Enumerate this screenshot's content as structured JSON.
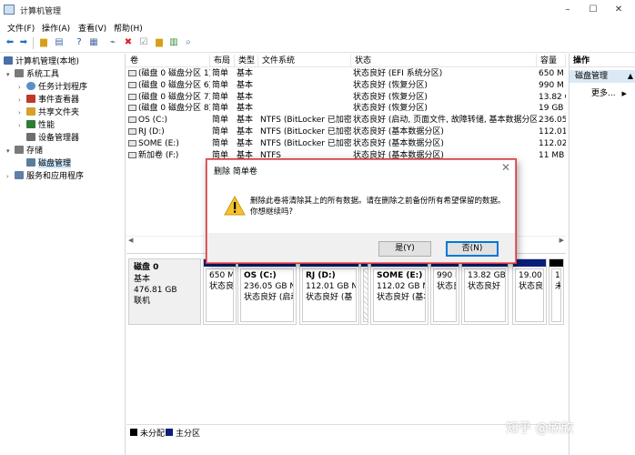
{
  "window": {
    "title": "计算机管理",
    "controls": [
      "–",
      "☐",
      "✕"
    ]
  },
  "menu": [
    "文件(F)",
    "操作(A)",
    "查看(V)",
    "帮助(H)"
  ],
  "toolbar": {
    "buttons": [
      "back-arrow-icon",
      "forward-arrow-icon",
      "folder-up-icon",
      "show-hide-tree-icon",
      "help-icon",
      "properties-icon",
      "connect-icon",
      "delete-icon",
      "check-icon",
      "folder-icon",
      "export-icon",
      "search-icon"
    ]
  },
  "tree": {
    "items": [
      {
        "label": "计算机管理(本地)",
        "twisty": "",
        "color": "#4a6fa5"
      },
      {
        "label": "系统工具",
        "twisty": "▾",
        "color": "#7a7a7a"
      },
      {
        "label": "任务计划程序",
        "twisty": "›",
        "color": "#5b8fc9"
      },
      {
        "label": "事件查看器",
        "twisty": "›",
        "color": "#c0392b"
      },
      {
        "label": "共享文件夹",
        "twisty": "›",
        "color": "#d6a02a"
      },
      {
        "label": "性能",
        "twisty": "›",
        "color": "#2e7d32"
      },
      {
        "label": "设备管理器",
        "twisty": "",
        "color": "#6d6d6d"
      },
      {
        "label": "存储",
        "twisty": "▾",
        "color": "#7a7a7a"
      },
      {
        "label": "磁盘管理",
        "twisty": "",
        "color": "#5b7d9c"
      },
      {
        "label": "服务和应用程序",
        "twisty": "›",
        "color": "#5e7fa8"
      }
    ]
  },
  "list": {
    "columns": [
      "卷",
      "布局",
      "类型",
      "文件系统",
      "状态",
      "容量"
    ],
    "rows": [
      [
        "(磁盘 0 磁盘分区 1)",
        "简单",
        "基本",
        "",
        "状态良好 (EFI 系统分区)",
        "650 M"
      ],
      [
        "(磁盘 0 磁盘分区 6)",
        "简单",
        "基本",
        "",
        "状态良好 (恢复分区)",
        "990 M"
      ],
      [
        "(磁盘 0 磁盘分区 7)",
        "简单",
        "基本",
        "",
        "状态良好 (恢复分区)",
        "13.82 G"
      ],
      [
        "(磁盘 0 磁盘分区 8)",
        "简单",
        "基本",
        "",
        "状态良好 (恢复分区)",
        "19 GB"
      ],
      [
        "OS (C:)",
        "简单",
        "基本",
        "NTFS (BitLocker 已加密)",
        "状态良好 (启动, 页面文件, 故障转储, 基本数据分区)",
        "236.05"
      ],
      [
        "RJ (D:)",
        "简单",
        "基本",
        "NTFS (BitLocker 已加密)",
        "状态良好 (基本数据分区)",
        "112.01"
      ],
      [
        "SOME (E:)",
        "简单",
        "基本",
        "NTFS (BitLocker 已加密)",
        "状态良好 (基本数据分区)",
        "112.02"
      ],
      [
        "新加卷 (F:)",
        "简单",
        "基本",
        "NTFS",
        "状态良好 (基本数据分区)",
        "11 MB"
      ]
    ]
  },
  "disk": {
    "name": "磁盘 0",
    "type": "基本",
    "size": "476.81 GB",
    "status": "联机",
    "partitions": [
      {
        "name": "",
        "size": "650 M",
        "status": "状态良"
      },
      {
        "name": "OS (C:)",
        "size": "236.05 GB NTI",
        "status": "状态良好 (启动"
      },
      {
        "name": "RJ (D:)",
        "size": "112.01 GB NT",
        "status": "状态良好 (基"
      },
      {
        "name": "",
        "size": "",
        "status": ""
      },
      {
        "name": "SOME (E:)",
        "size": "112.02 GB NTF",
        "status": "状态良好 (基本"
      },
      {
        "name": "",
        "size": "990 M",
        "status": "状态良"
      },
      {
        "name": "",
        "size": "13.82 GB",
        "status": "状态良好"
      },
      {
        "name": "",
        "size": "19.00 GB",
        "status": "状态良好"
      },
      {
        "name": "",
        "size": "1",
        "status": "未"
      }
    ]
  },
  "legend": [
    {
      "label": "未分配",
      "color": "#000000"
    },
    {
      "label": "主分区",
      "color": "#0a1e7a"
    }
  ],
  "actions": {
    "header": "操作",
    "selected": "磁盘管理",
    "more": "更多..."
  },
  "dialog": {
    "title": "删除 简单卷",
    "message": "删除此卷将清除其上的所有数据。请在删除之前备份所有希望保留的数据。你想继续吗?",
    "yes": "是(Y)",
    "no": "否(N)"
  },
  "watermark": "知乎 @欣欣",
  "colors": {
    "accent": "#0078d7",
    "partition_bar": "#0a1e7a",
    "dialog_border": "#d23a3a"
  }
}
